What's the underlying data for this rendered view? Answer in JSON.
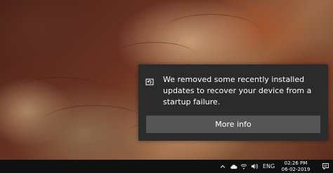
{
  "toast": {
    "message": "We removed some recently installed updates to recover your device from a startup failure.",
    "button_label": "More info"
  },
  "taskbar": {
    "language": "ENG",
    "time": "02:26 PM",
    "date": "06-02-2019"
  },
  "icons": {
    "toast": "update-recovery-icon",
    "tray": [
      "chevron-up-icon",
      "cloud-icon",
      "wifi-icon",
      "volume-icon",
      "language-indicator",
      "action-center-icon"
    ]
  },
  "colors": {
    "toast_bg": "#2b2b2b",
    "button_bg": "#555555",
    "taskbar_bg": "#101010"
  }
}
